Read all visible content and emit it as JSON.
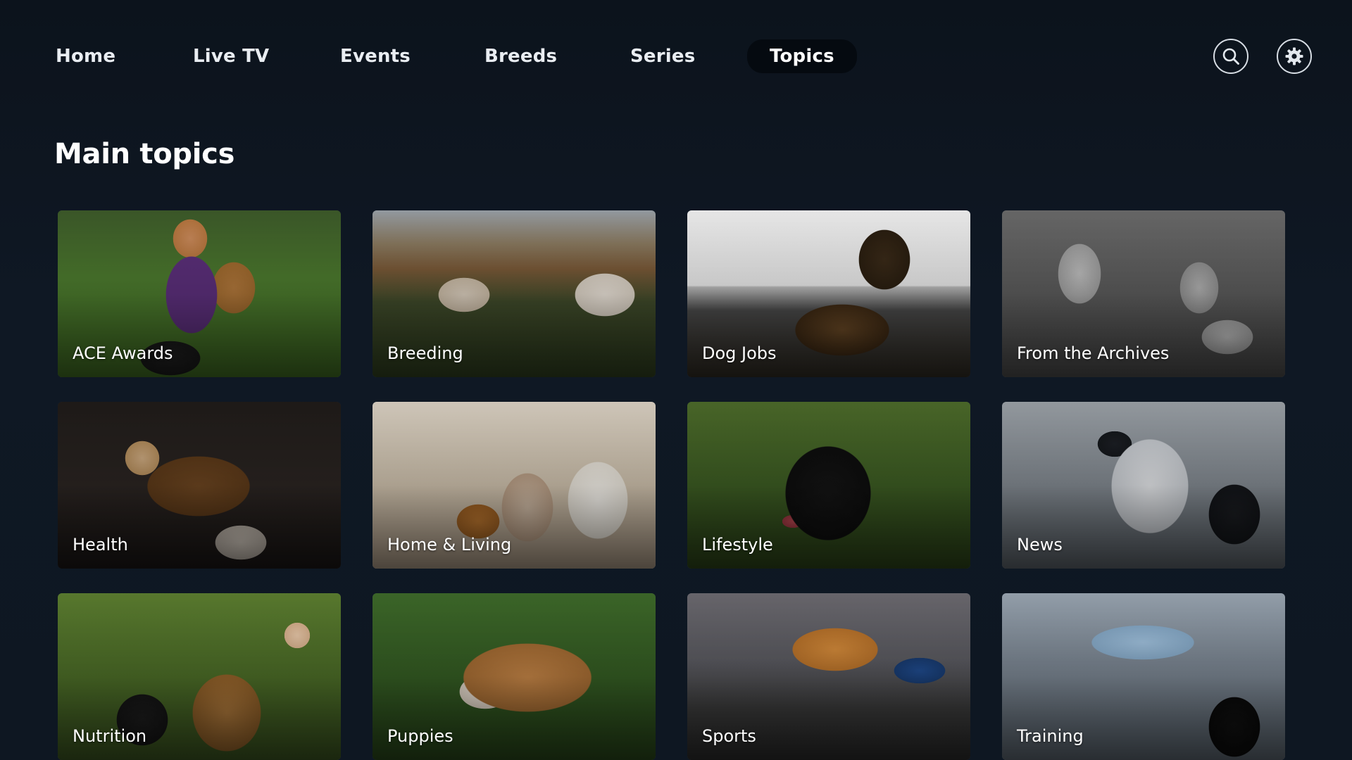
{
  "nav": {
    "items": [
      {
        "label": "Home"
      },
      {
        "label": "Live TV"
      },
      {
        "label": "Events"
      },
      {
        "label": "Breeds"
      },
      {
        "label": "Series"
      },
      {
        "label": "Topics",
        "active": true
      }
    ],
    "search_icon": "search-icon",
    "settings_icon": "gear-icon"
  },
  "main": {
    "title": "Main topics",
    "tiles": [
      {
        "label": "ACE Awards"
      },
      {
        "label": "Breeding"
      },
      {
        "label": "Dog Jobs"
      },
      {
        "label": "From the Archives"
      },
      {
        "label": "Health"
      },
      {
        "label": "Home & Living"
      },
      {
        "label": "Lifestyle"
      },
      {
        "label": "News"
      },
      {
        "label": "Nutrition"
      },
      {
        "label": "Puppies"
      },
      {
        "label": "Sports"
      },
      {
        "label": "Training"
      }
    ]
  },
  "colors": {
    "background": "#0e1621",
    "active_pill": "#050a10",
    "text": "#ffffff"
  }
}
